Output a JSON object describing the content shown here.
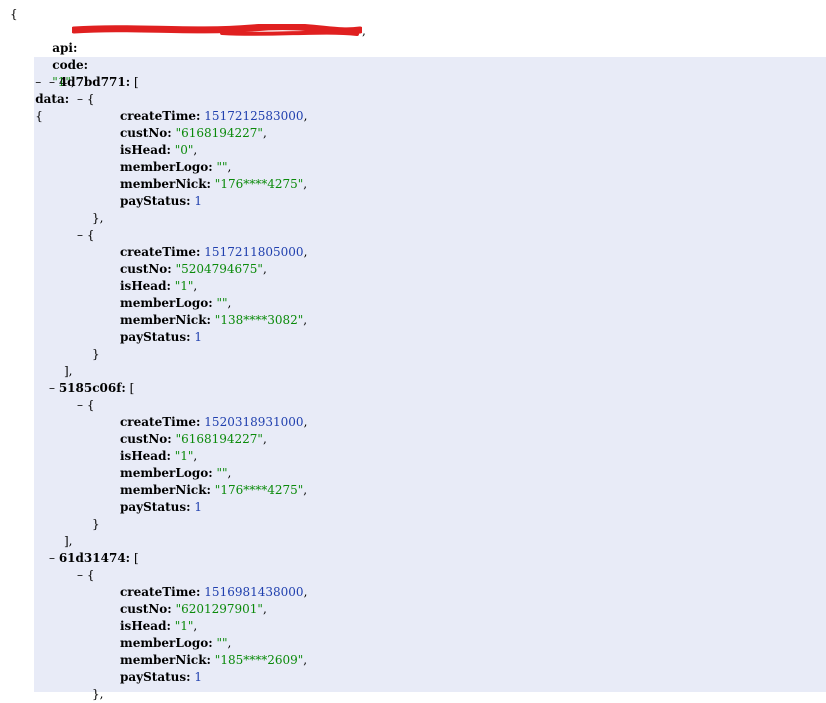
{
  "root": {
    "open_brace": "{"
  },
  "api": {
    "key": "api:",
    "value_visible": "\"…\"",
    "comma": ","
  },
  "code": {
    "key": "code:",
    "value": "\"1\"",
    "comma": ","
  },
  "data": {
    "toggle": "–",
    "key": "data:",
    "open": "{"
  },
  "groups": [
    {
      "toggle": "–",
      "key": "4d7bd771:",
      "open": "[",
      "close": "],",
      "items": [
        {
          "toggle": "–",
          "open": "{",
          "close": "},",
          "createTime": "1517212583000",
          "custNo": "\"6168194227\"",
          "isHead": "\"0\"",
          "memberLogo": "\"\"",
          "memberNick": "\"176****4275\"",
          "payStatus": "1"
        },
        {
          "toggle": "–",
          "open": "{",
          "close": "}",
          "createTime": "1517211805000",
          "custNo": "\"5204794675\"",
          "isHead": "\"1\"",
          "memberLogo": "\"\"",
          "memberNick": "\"138****3082\"",
          "payStatus": "1"
        }
      ]
    },
    {
      "toggle": "–",
      "key": "5185c06f:",
      "open": "[",
      "close": "],",
      "items": [
        {
          "toggle": "–",
          "open": "{",
          "close": "}",
          "createTime": "1520318931000",
          "custNo": "\"6168194227\"",
          "isHead": "\"1\"",
          "memberLogo": "\"\"",
          "memberNick": "\"176****4275\"",
          "payStatus": "1"
        }
      ]
    },
    {
      "toggle": "–",
      "key": "61d31474:",
      "open": "[",
      "close": "",
      "items": [
        {
          "toggle": "–",
          "open": "{",
          "close": "},",
          "createTime": "1516981438000",
          "custNo": "\"6201297901\"",
          "isHead": "\"1\"",
          "memberLogo": "\"\"",
          "memberNick": "\"185****2609\"",
          "payStatus": "1"
        }
      ]
    }
  ],
  "field_labels": {
    "createTime": "createTime:",
    "custNo": "custNo:",
    "isHead": "isHead:",
    "memberLogo": "memberLogo:",
    "memberNick": "memberNick:",
    "payStatus": "payStatus:"
  },
  "colors": {
    "string": "#0a8a0a",
    "number": "#1f3fae",
    "highlight": "#e8ebf7",
    "redaction": "#e02020"
  }
}
